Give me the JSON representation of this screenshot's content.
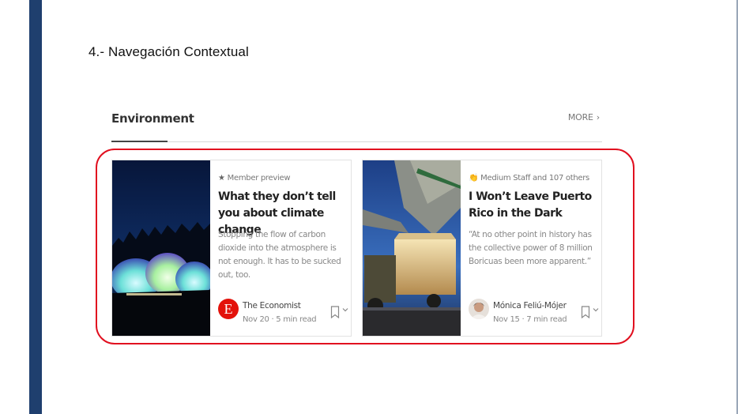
{
  "slide": {
    "title": "4.- Navegación Contextual"
  },
  "section": {
    "title": "Environment",
    "more_label": "MORE",
    "more_icon": "chevron-right-icon"
  },
  "cards": [
    {
      "meta_icon": "star-icon",
      "meta": "Member preview",
      "title": "What they don’t tell you about climate change",
      "description": "Stopping the flow of carbon dioxide into the atmosphere is not enough. It has to be sucked out, too.",
      "author": "The Economist",
      "author_avatar_letter": "E",
      "date_read": "Nov 20 · 5 min read"
    },
    {
      "meta_icon": "clap-icon",
      "meta": "Medium Staff and 107 others",
      "title": "I Won’t Leave Puerto Rico in the Dark",
      "description": "“At no other point in history has the collective power of 8 million Boricuas been more apparent.”",
      "author": "Mónica Feliú-Mójer",
      "date_read": "Nov 15 · 7 min read"
    }
  ],
  "colors": {
    "slide_bar": "#1f3f6e",
    "highlight": "#e10f1f",
    "economist_red": "#e3120b"
  }
}
